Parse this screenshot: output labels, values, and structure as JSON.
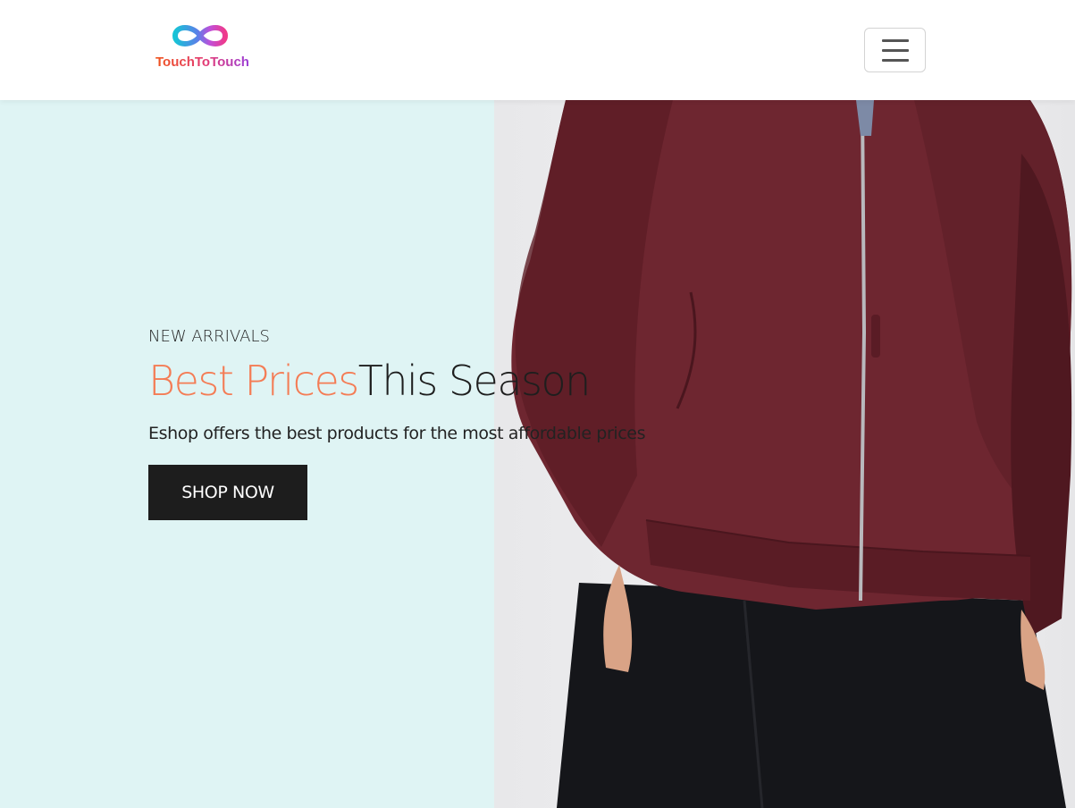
{
  "brand": {
    "name": "TouchToTouch",
    "logo_icon": "infinity-icon",
    "colors": {
      "orange": "#f0541c",
      "pink": "#e23a78",
      "purple": "#9b3fd9",
      "cyan": "#17c3d6"
    }
  },
  "nav": {
    "menu_icon": "hamburger-icon"
  },
  "hero": {
    "eyebrow": "NEW ARRIVALS",
    "headline_accent": "Best Prices",
    "headline_rest": "This Season",
    "subtitle": "Eshop offers the best products for the most affordable prices",
    "cta_label": "SHOP NOW",
    "accent_color": "#f47c55",
    "left_background": "#dff4f4",
    "image_subject": "man in burgundy bomber jacket and black trousers"
  }
}
